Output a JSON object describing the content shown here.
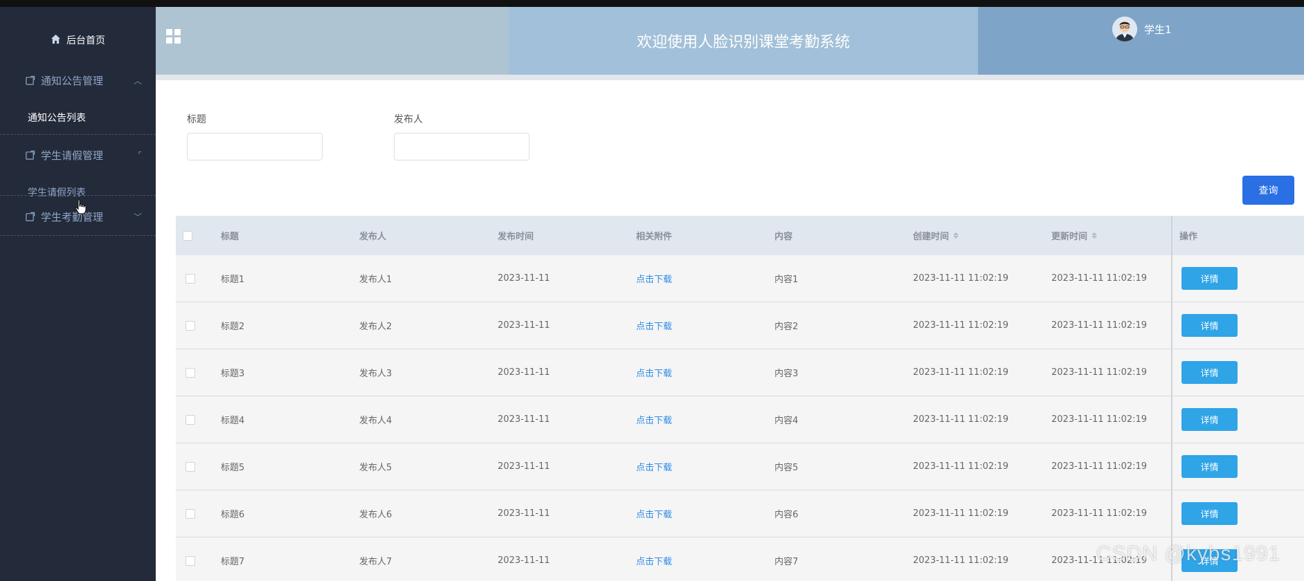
{
  "sidebar": {
    "home_label": "后台首页",
    "groups": [
      {
        "label": "通知公告管理",
        "sub": "通知公告列表"
      },
      {
        "label": "学生请假管理",
        "sub": "学生请假列表"
      },
      {
        "label": "学生考勤管理"
      }
    ]
  },
  "header": {
    "title": "欢迎使用人脸识别课堂考勤系统",
    "username": "学生1"
  },
  "search": {
    "title_label": "标题",
    "title_value": "",
    "publisher_label": "发布人",
    "publisher_value": "",
    "query_button": "查询"
  },
  "table": {
    "columns": [
      "标题",
      "发布人",
      "发布时间",
      "相关附件",
      "内容",
      "创建时间",
      "更新时间",
      "操作"
    ],
    "rows": [
      {
        "title": "标题1",
        "publisher": "发布人1",
        "date": "2023-11-11",
        "attachment": "点击下载",
        "content": "内容1",
        "created": "2023-11-11 11:02:19",
        "updated": "2023-11-11 11:02:19",
        "action": "详情"
      },
      {
        "title": "标题2",
        "publisher": "发布人2",
        "date": "2023-11-11",
        "attachment": "点击下载",
        "content": "内容2",
        "created": "2023-11-11 11:02:19",
        "updated": "2023-11-11 11:02:19",
        "action": "详情"
      },
      {
        "title": "标题3",
        "publisher": "发布人3",
        "date": "2023-11-11",
        "attachment": "点击下载",
        "content": "内容3",
        "created": "2023-11-11 11:02:19",
        "updated": "2023-11-11 11:02:19",
        "action": "详情"
      },
      {
        "title": "标题4",
        "publisher": "发布人4",
        "date": "2023-11-11",
        "attachment": "点击下载",
        "content": "内容4",
        "created": "2023-11-11 11:02:19",
        "updated": "2023-11-11 11:02:19",
        "action": "详情"
      },
      {
        "title": "标题5",
        "publisher": "发布人5",
        "date": "2023-11-11",
        "attachment": "点击下载",
        "content": "内容5",
        "created": "2023-11-11 11:02:19",
        "updated": "2023-11-11 11:02:19",
        "action": "详情"
      },
      {
        "title": "标题6",
        "publisher": "发布人6",
        "date": "2023-11-11",
        "attachment": "点击下载",
        "content": "内容6",
        "created": "2023-11-11 11:02:19",
        "updated": "2023-11-11 11:02:19",
        "action": "详情"
      },
      {
        "title": "标题7",
        "publisher": "发布人7",
        "date": "2023-11-11",
        "attachment": "点击下载",
        "content": "内容7",
        "created": "2023-11-11 11:02:19",
        "updated": "2023-11-11 11:02:19",
        "action": "详情"
      }
    ]
  },
  "watermark": "CSDN @kybs1991",
  "colors": {
    "sidebar_bg": "#232a3a",
    "header_left": "#afc4d3",
    "header_mid": "#a2c0d9",
    "header_right": "#7ea5c8",
    "query_button": "#2a6fe3",
    "detail_button": "#2fa4e7",
    "link": "#2c8be8"
  },
  "icons": [
    "home-icon",
    "menu-grid-icon",
    "folder-icon",
    "chevron-up-icon",
    "chevron-down-icon",
    "sort-icon",
    "hand-cursor-icon"
  ]
}
